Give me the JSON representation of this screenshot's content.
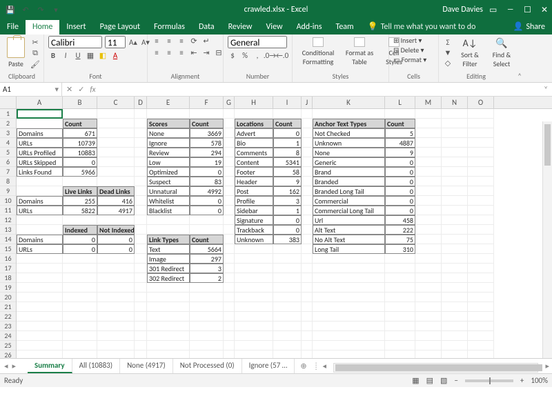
{
  "title": "crawled.xlsx - Excel",
  "user": "Dave Davies",
  "tabs": [
    "File",
    "Home",
    "Insert",
    "Page Layout",
    "Formulas",
    "Data",
    "Review",
    "View",
    "Add-ins",
    "Team"
  ],
  "active_tab": "Home",
  "tellme": "Tell me what you want to do",
  "share": "Share",
  "ribbon": {
    "clipboard": {
      "paste": "Paste",
      "label": "Clipboard"
    },
    "font": {
      "family": "Calibri",
      "size": "11",
      "label": "Font"
    },
    "alignment": {
      "label": "Alignment"
    },
    "number": {
      "format": "General",
      "label": "Number"
    },
    "styles": {
      "cond": "Conditional Formatting",
      "fmt": "Format as Table",
      "cell": "Cell Styles",
      "label": "Styles"
    },
    "cells": {
      "insert": "Insert",
      "delete": "Delete",
      "format": "Format",
      "label": "Cells"
    },
    "editing": {
      "sort": "Sort & Filter",
      "find": "Find & Select",
      "label": "Editing"
    }
  },
  "namebox": "A1",
  "columns": [
    "A",
    "B",
    "C",
    "D",
    "E",
    "F",
    "G",
    "H",
    "I",
    "J",
    "K",
    "L",
    "M",
    "N",
    "O"
  ],
  "col_classes": [
    "colA",
    "colB",
    "colC",
    "colD",
    "colE",
    "colF",
    "colG",
    "colH",
    "colI",
    "colJ",
    "colK",
    "colL",
    "colM",
    "colN",
    "colO"
  ],
  "row_count": 26,
  "cells": {
    "B2": {
      "t": "Count",
      "h": 1
    },
    "A3": {
      "t": "Domains",
      "b": 1
    },
    "B3": {
      "t": "671",
      "b": 1,
      "r": 1
    },
    "A4": {
      "t": "URLs",
      "b": 1
    },
    "B4": {
      "t": "10739",
      "b": 1,
      "r": 1
    },
    "A5": {
      "t": "URLs Profiled",
      "b": 1
    },
    "B5": {
      "t": "10883",
      "b": 1,
      "r": 1
    },
    "A6": {
      "t": "URLs Skipped",
      "b": 1
    },
    "B6": {
      "t": "0",
      "b": 1,
      "r": 1
    },
    "A7": {
      "t": "Links Found",
      "b": 1
    },
    "B7": {
      "t": "5966",
      "b": 1,
      "r": 1
    },
    "B9": {
      "t": "Live Links",
      "h": 1
    },
    "C9": {
      "t": "Dead Links",
      "h": 1
    },
    "A10": {
      "t": "Domains",
      "b": 1
    },
    "B10": {
      "t": "255",
      "b": 1,
      "r": 1
    },
    "C10": {
      "t": "416",
      "b": 1,
      "r": 1
    },
    "A11": {
      "t": "URLs",
      "b": 1
    },
    "B11": {
      "t": "5822",
      "b": 1,
      "r": 1
    },
    "C11": {
      "t": "4917",
      "b": 1,
      "r": 1
    },
    "B13": {
      "t": "Indexed",
      "h": 1
    },
    "C13": {
      "t": "Not Indexed",
      "h": 1
    },
    "A14": {
      "t": "Domains",
      "b": 1
    },
    "B14": {
      "t": "0",
      "b": 1,
      "r": 1
    },
    "C14": {
      "t": "0",
      "b": 1,
      "r": 1
    },
    "A15": {
      "t": "URLs",
      "b": 1
    },
    "B15": {
      "t": "0",
      "b": 1,
      "r": 1
    },
    "C15": {
      "t": "0",
      "b": 1,
      "r": 1
    },
    "E2": {
      "t": "Scores",
      "h": 1
    },
    "F2": {
      "t": "Count",
      "h": 1
    },
    "E3": {
      "t": "None",
      "b": 1
    },
    "F3": {
      "t": "3669",
      "b": 1,
      "r": 1
    },
    "E4": {
      "t": "Ignore",
      "b": 1
    },
    "F4": {
      "t": "578",
      "b": 1,
      "r": 1
    },
    "E5": {
      "t": "Review",
      "b": 1
    },
    "F5": {
      "t": "294",
      "b": 1,
      "r": 1
    },
    "E6": {
      "t": "Low",
      "b": 1
    },
    "F6": {
      "t": "19",
      "b": 1,
      "r": 1
    },
    "E7": {
      "t": "Optimized",
      "b": 1
    },
    "F7": {
      "t": "0",
      "b": 1,
      "r": 1
    },
    "E8": {
      "t": "Suspect",
      "b": 1
    },
    "F8": {
      "t": "83",
      "b": 1,
      "r": 1
    },
    "E9": {
      "t": "Unnatural",
      "b": 1
    },
    "F9": {
      "t": "4992",
      "b": 1,
      "r": 1
    },
    "E10": {
      "t": "Whitelist",
      "b": 1
    },
    "F10": {
      "t": "0",
      "b": 1,
      "r": 1
    },
    "E11": {
      "t": "Blacklist",
      "b": 1
    },
    "F11": {
      "t": "0",
      "b": 1,
      "r": 1
    },
    "E14": {
      "t": "Link Types",
      "h": 1
    },
    "F14": {
      "t": "Count",
      "h": 1
    },
    "E15": {
      "t": "Text",
      "b": 1
    },
    "F15": {
      "t": "5664",
      "b": 1,
      "r": 1
    },
    "E16": {
      "t": "Image",
      "b": 1
    },
    "F16": {
      "t": "297",
      "b": 1,
      "r": 1
    },
    "E17": {
      "t": "301 Redirect",
      "b": 1
    },
    "F17": {
      "t": "3",
      "b": 1,
      "r": 1
    },
    "E18": {
      "t": "302 Redirect",
      "b": 1
    },
    "F18": {
      "t": "2",
      "b": 1,
      "r": 1
    },
    "H2": {
      "t": "Locations",
      "h": 1
    },
    "I2": {
      "t": "Count",
      "h": 1
    },
    "H3": {
      "t": "Advert",
      "b": 1
    },
    "I3": {
      "t": "0",
      "b": 1,
      "r": 1
    },
    "H4": {
      "t": "Bio",
      "b": 1
    },
    "I4": {
      "t": "1",
      "b": 1,
      "r": 1
    },
    "H5": {
      "t": "Comments",
      "b": 1
    },
    "I5": {
      "t": "8",
      "b": 1,
      "r": 1
    },
    "H6": {
      "t": "Content",
      "b": 1
    },
    "I6": {
      "t": "5341",
      "b": 1,
      "r": 1
    },
    "H7": {
      "t": "Footer",
      "b": 1
    },
    "I7": {
      "t": "58",
      "b": 1,
      "r": 1
    },
    "H8": {
      "t": "Header",
      "b": 1
    },
    "I8": {
      "t": "9",
      "b": 1,
      "r": 1
    },
    "H9": {
      "t": "Post",
      "b": 1
    },
    "I9": {
      "t": "162",
      "b": 1,
      "r": 1
    },
    "H10": {
      "t": "Profile",
      "b": 1
    },
    "I10": {
      "t": "3",
      "b": 1,
      "r": 1
    },
    "H11": {
      "t": "Sidebar",
      "b": 1
    },
    "I11": {
      "t": "1",
      "b": 1,
      "r": 1
    },
    "H12": {
      "t": "Signature",
      "b": 1
    },
    "I12": {
      "t": "0",
      "b": 1,
      "r": 1
    },
    "H13": {
      "t": "Trackback",
      "b": 1
    },
    "I13": {
      "t": "0",
      "b": 1,
      "r": 1
    },
    "H14": {
      "t": "Unknown",
      "b": 1
    },
    "I14": {
      "t": "383",
      "b": 1,
      "r": 1
    },
    "K2": {
      "t": "Anchor Text Types",
      "h": 1
    },
    "L2": {
      "t": "Count",
      "h": 1
    },
    "K3": {
      "t": "Not Checked",
      "b": 1
    },
    "L3": {
      "t": "5",
      "b": 1,
      "r": 1
    },
    "K4": {
      "t": "Unknown",
      "b": 1
    },
    "L4": {
      "t": "4887",
      "b": 1,
      "r": 1
    },
    "K5": {
      "t": "None",
      "b": 1
    },
    "L5": {
      "t": "9",
      "b": 1,
      "r": 1
    },
    "K6": {
      "t": "Generic",
      "b": 1
    },
    "L6": {
      "t": "0",
      "b": 1,
      "r": 1
    },
    "K7": {
      "t": "Brand",
      "b": 1
    },
    "L7": {
      "t": "0",
      "b": 1,
      "r": 1
    },
    "K8": {
      "t": "Branded",
      "b": 1
    },
    "L8": {
      "t": "0",
      "b": 1,
      "r": 1
    },
    "K9": {
      "t": "Branded Long Tail",
      "b": 1
    },
    "L9": {
      "t": "0",
      "b": 1,
      "r": 1
    },
    "K10": {
      "t": "Commercial",
      "b": 1
    },
    "L10": {
      "t": "0",
      "b": 1,
      "r": 1
    },
    "K11": {
      "t": "Commercial Long Tail",
      "b": 1
    },
    "L11": {
      "t": "0",
      "b": 1,
      "r": 1
    },
    "K12": {
      "t": "Url",
      "b": 1
    },
    "L12": {
      "t": "458",
      "b": 1,
      "r": 1
    },
    "K13": {
      "t": "Alt Text",
      "b": 1
    },
    "L13": {
      "t": "222",
      "b": 1,
      "r": 1
    },
    "K14": {
      "t": "No Alt Text",
      "b": 1
    },
    "L14": {
      "t": "75",
      "b": 1,
      "r": 1
    },
    "K15": {
      "t": "Long Tail",
      "b": 1
    },
    "L15": {
      "t": "310",
      "b": 1,
      "r": 1
    }
  },
  "sheets": [
    "Summary",
    "All (10883)",
    "None (4917)",
    "Not Processed (0)",
    "Ignore (57 …"
  ],
  "active_sheet": "Summary",
  "status": "Ready",
  "zoom": "100%"
}
